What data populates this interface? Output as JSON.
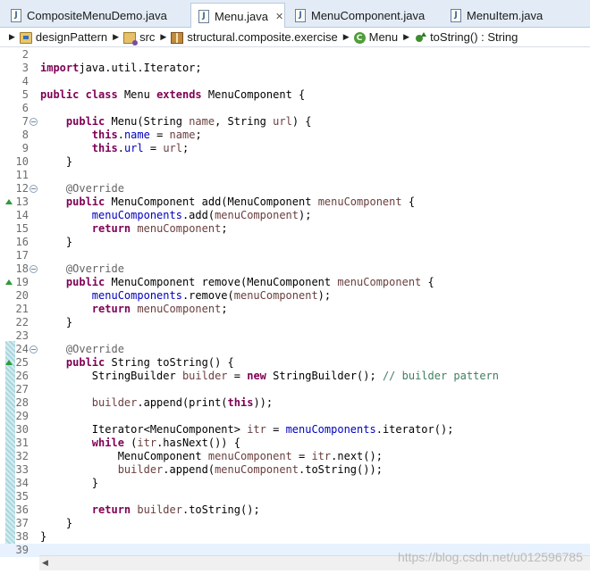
{
  "tabs": [
    {
      "label": "CompositeMenuDemo.java",
      "icon": "java-file-icon",
      "active": false
    },
    {
      "label": "Menu.java",
      "icon": "java-file-icon",
      "active": true,
      "close": "✕"
    },
    {
      "label": "MenuComponent.java",
      "icon": "java-file-icon",
      "active": false
    },
    {
      "label": "MenuItem.java",
      "icon": "java-file-icon",
      "active": false
    }
  ],
  "breadcrumb": {
    "project": "designPattern",
    "source_folder": "src",
    "package": "structural.composite.exercise",
    "class": "Menu",
    "method": "toString() : String"
  },
  "watermark": "https://blog.csdn.net/u012596785",
  "colors": {
    "keyword": "#7f0055",
    "field": "#0000c0",
    "parameter": "#6a3e3e",
    "annotation": "#646464",
    "comment": "#3f7f5f",
    "current_line": "#e8f2fe"
  },
  "lines": [
    {
      "n": "2",
      "t": []
    },
    {
      "n": "3",
      "t": [
        [
          "kw",
          "import"
        ],
        [
          "",
          "java.util.Iterator;"
        ]
      ]
    },
    {
      "n": "4",
      "t": []
    },
    {
      "n": "5",
      "t": [
        [
          "kw",
          "public"
        ],
        [
          "",
          " "
        ],
        [
          "kw",
          "class"
        ],
        [
          "",
          " Menu "
        ],
        [
          "kw",
          "extends"
        ],
        [
          "",
          " MenuComponent {"
        ]
      ]
    },
    {
      "n": "6",
      "t": []
    },
    {
      "n": "7",
      "fold": true,
      "t": [
        [
          "",
          "    "
        ],
        [
          "kw",
          "public"
        ],
        [
          "",
          " Menu(String "
        ],
        [
          "prm",
          "name"
        ],
        [
          "",
          ", String "
        ],
        [
          "prm",
          "url"
        ],
        [
          "",
          ") {"
        ]
      ]
    },
    {
      "n": "8",
      "t": [
        [
          "",
          "        "
        ],
        [
          "kw",
          "this"
        ],
        [
          "",
          "."
        ],
        [
          "fld",
          "name"
        ],
        [
          "",
          " = "
        ],
        [
          "prm",
          "name"
        ],
        [
          "",
          ";"
        ]
      ]
    },
    {
      "n": "9",
      "t": [
        [
          "",
          "        "
        ],
        [
          "kw",
          "this"
        ],
        [
          "",
          "."
        ],
        [
          "fld",
          "url"
        ],
        [
          "",
          " = "
        ],
        [
          "prm",
          "url"
        ],
        [
          "",
          ";"
        ]
      ]
    },
    {
      "n": "10",
      "t": [
        [
          "",
          "    }"
        ]
      ]
    },
    {
      "n": "11",
      "t": []
    },
    {
      "n": "12",
      "fold": true,
      "t": [
        [
          "",
          "    "
        ],
        [
          "ann",
          "@Override"
        ]
      ]
    },
    {
      "n": "13",
      "override": true,
      "t": [
        [
          "",
          "    "
        ],
        [
          "kw",
          "public"
        ],
        [
          "",
          " MenuComponent add(MenuComponent "
        ],
        [
          "prm",
          "menuComponent"
        ],
        [
          "",
          " {"
        ]
      ]
    },
    {
      "n": "14",
      "t": [
        [
          "",
          "        "
        ],
        [
          "fld",
          "menuComponents"
        ],
        [
          "",
          ".add("
        ],
        [
          "prm",
          "menuComponent"
        ],
        [
          "",
          ");"
        ]
      ]
    },
    {
      "n": "15",
      "t": [
        [
          "",
          "        "
        ],
        [
          "kw",
          "return"
        ],
        [
          "",
          " "
        ],
        [
          "prm",
          "menuComponent"
        ],
        [
          "",
          ";"
        ]
      ]
    },
    {
      "n": "16",
      "t": [
        [
          "",
          "    }"
        ]
      ]
    },
    {
      "n": "17",
      "t": []
    },
    {
      "n": "18",
      "fold": true,
      "t": [
        [
          "",
          "    "
        ],
        [
          "ann",
          "@Override"
        ]
      ]
    },
    {
      "n": "19",
      "override": true,
      "t": [
        [
          "",
          "    "
        ],
        [
          "kw",
          "public"
        ],
        [
          "",
          " MenuComponent remove(MenuComponent "
        ],
        [
          "prm",
          "menuComponent"
        ],
        [
          "",
          " {"
        ]
      ]
    },
    {
      "n": "20",
      "t": [
        [
          "",
          "        "
        ],
        [
          "fld",
          "menuComponents"
        ],
        [
          "",
          ".remove("
        ],
        [
          "prm",
          "menuComponent"
        ],
        [
          "",
          ");"
        ]
      ]
    },
    {
      "n": "21",
      "t": [
        [
          "",
          "        "
        ],
        [
          "kw",
          "return"
        ],
        [
          "",
          " "
        ],
        [
          "prm",
          "menuComponent"
        ],
        [
          "",
          ";"
        ]
      ]
    },
    {
      "n": "22",
      "t": [
        [
          "",
          "    }"
        ]
      ]
    },
    {
      "n": "23",
      "t": []
    },
    {
      "n": "24",
      "fold": true,
      "t": [
        [
          "",
          "    "
        ],
        [
          "ann",
          "@Override"
        ]
      ]
    },
    {
      "n": "25",
      "override": true,
      "t": [
        [
          "",
          "    "
        ],
        [
          "kw",
          "public"
        ],
        [
          "",
          " String toString() {"
        ]
      ]
    },
    {
      "n": "26",
      "t": [
        [
          "",
          "        StringBuilder "
        ],
        [
          "prm",
          "builder"
        ],
        [
          "",
          " = "
        ],
        [
          "kw",
          "new"
        ],
        [
          "",
          " StringBuilder(); "
        ],
        [
          "cmt",
          "// builder pattern"
        ]
      ]
    },
    {
      "n": "27",
      "t": []
    },
    {
      "n": "28",
      "t": [
        [
          "",
          "        "
        ],
        [
          "prm",
          "builder"
        ],
        [
          "",
          ".append(print("
        ],
        [
          "kw",
          "this"
        ],
        [
          "",
          "));"
        ]
      ]
    },
    {
      "n": "29",
      "t": []
    },
    {
      "n": "30",
      "t": [
        [
          "",
          "        Iterator<MenuComponent> "
        ],
        [
          "prm",
          "itr"
        ],
        [
          "",
          " = "
        ],
        [
          "fld",
          "menuComponents"
        ],
        [
          "",
          ".iterator();"
        ]
      ]
    },
    {
      "n": "31",
      "t": [
        [
          "",
          "        "
        ],
        [
          "kw",
          "while"
        ],
        [
          "",
          " ("
        ],
        [
          "prm",
          "itr"
        ],
        [
          "",
          ".hasNext()) {"
        ]
      ]
    },
    {
      "n": "32",
      "t": [
        [
          "",
          "            MenuComponent "
        ],
        [
          "prm",
          "menuComponent"
        ],
        [
          "",
          " = "
        ],
        [
          "prm",
          "itr"
        ],
        [
          "",
          ".next();"
        ]
      ]
    },
    {
      "n": "33",
      "t": [
        [
          "",
          "            "
        ],
        [
          "prm",
          "builder"
        ],
        [
          "",
          ".append("
        ],
        [
          "prm",
          "menuComponent"
        ],
        [
          "",
          ".toString());"
        ]
      ]
    },
    {
      "n": "34",
      "t": [
        [
          "",
          "        }"
        ]
      ]
    },
    {
      "n": "35",
      "t": []
    },
    {
      "n": "36",
      "t": [
        [
          "",
          "        "
        ],
        [
          "kw",
          "return"
        ],
        [
          "",
          " "
        ],
        [
          "prm",
          "builder"
        ],
        [
          "",
          ".toString();"
        ]
      ]
    },
    {
      "n": "37",
      "t": [
        [
          "",
          "    }"
        ]
      ]
    },
    {
      "n": "38",
      "t": [
        [
          "",
          "}"
        ]
      ]
    },
    {
      "n": "39",
      "current": true,
      "t": []
    }
  ]
}
